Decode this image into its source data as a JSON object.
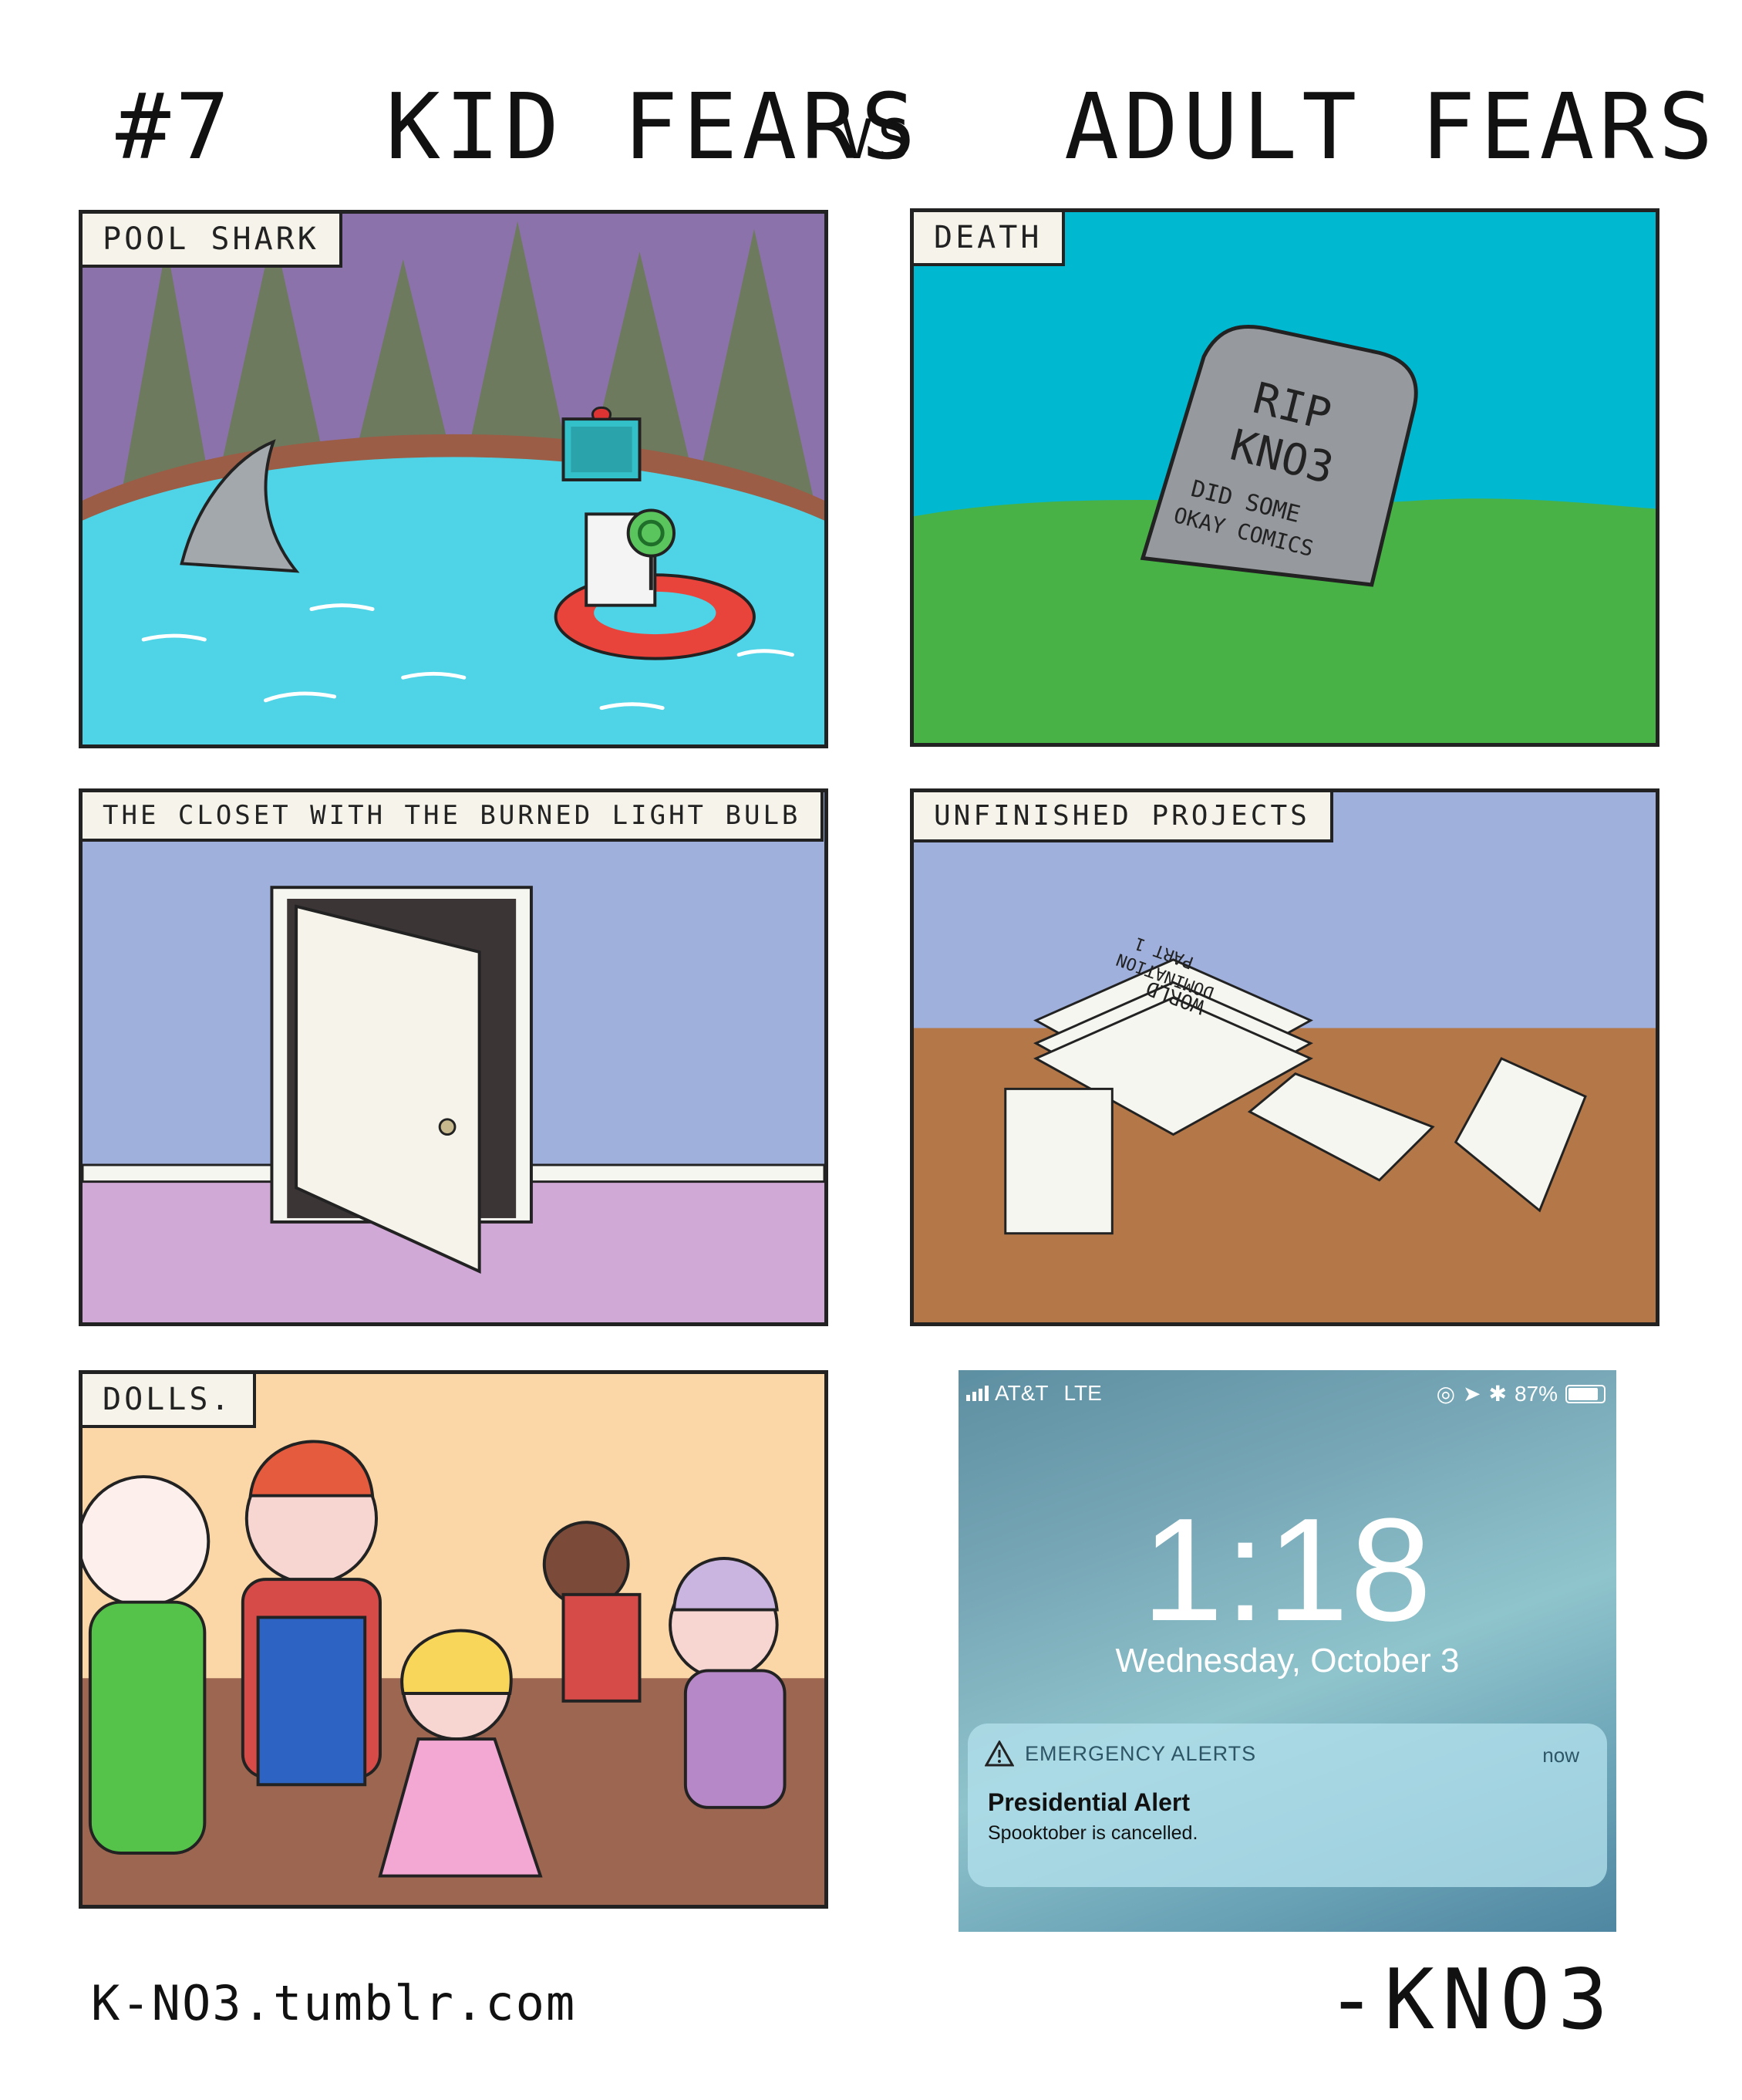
{
  "header": {
    "number": "#7",
    "kid_title": "KID FEARS",
    "vs": "VS",
    "adult_title": "ADULT FEARS"
  },
  "panels": {
    "pool_shark": {
      "caption": "POOL SHARK"
    },
    "death": {
      "caption": "DEATH",
      "tombstone_line1": "RIP",
      "tombstone_line2": "KNO3",
      "tombstone_line3": "DID SOME",
      "tombstone_line4": "OKAY COMICS"
    },
    "closet": {
      "caption": "THE CLOSET WITH THE BURNED LIGHT BULB"
    },
    "projects": {
      "caption": "UNFINISHED PROJECTS",
      "paper_line1": "WORLD",
      "paper_line2": "DOMINATION",
      "paper_line3": "PART 1"
    },
    "dolls": {
      "caption": "DOLLS."
    },
    "phone": {
      "carrier": "AT&T",
      "network": "LTE",
      "battery": "87%",
      "time": "1:18",
      "date": "Wednesday, October 3",
      "alert_app": "EMERGENCY ALERTS",
      "alert_time": "now",
      "alert_title": "Presidential Alert",
      "alert_body": "Spooktober is cancelled."
    }
  },
  "footer": {
    "site": "K-NO3.tumblr.com",
    "signature": "-KNO3"
  },
  "colors": {
    "pool_water": "#4fd3e6",
    "sky_death": "#00b8d0",
    "grass": "#49b247",
    "wall_blue": "#9fb0dc",
    "floor_purple": "#d1a9d6",
    "floor_brown": "#b47848",
    "doll_wall": "#fbd6a6",
    "doll_floor": "#9c6650"
  }
}
